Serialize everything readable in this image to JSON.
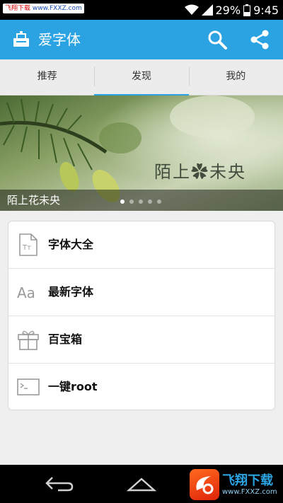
{
  "status_bar": {
    "watermark_prefix": "飞翔下载",
    "watermark_url": "www.FXXZ.com",
    "battery": "29%",
    "time": "9:45",
    "icons": [
      "wifi-icon",
      "signal-icon",
      "battery-icon"
    ]
  },
  "app_bar": {
    "title": "爱字体",
    "accent_color": "#2ba3e3",
    "icons": [
      "app-logo-icon",
      "search-icon",
      "share-icon"
    ]
  },
  "tabs": [
    {
      "label": "推荐",
      "active": false
    },
    {
      "label": "发现",
      "active": true
    },
    {
      "label": "我的",
      "active": false
    }
  ],
  "banner": {
    "caption": "陌上花未央",
    "image_text": "陌上✿未央",
    "slide_count": 5,
    "active_slide": 1
  },
  "menu": {
    "items": [
      {
        "label": "字体大全",
        "icon": "font-file-icon"
      },
      {
        "label": "最新字体",
        "icon": "aa-letters-icon"
      },
      {
        "label": "百宝箱",
        "icon": "gift-box-icon"
      },
      {
        "label": "一键root",
        "icon": "terminal-icon"
      }
    ]
  },
  "bottom_watermark": {
    "brand": "飞翔下载",
    "url": "www.FXXZ.com"
  }
}
